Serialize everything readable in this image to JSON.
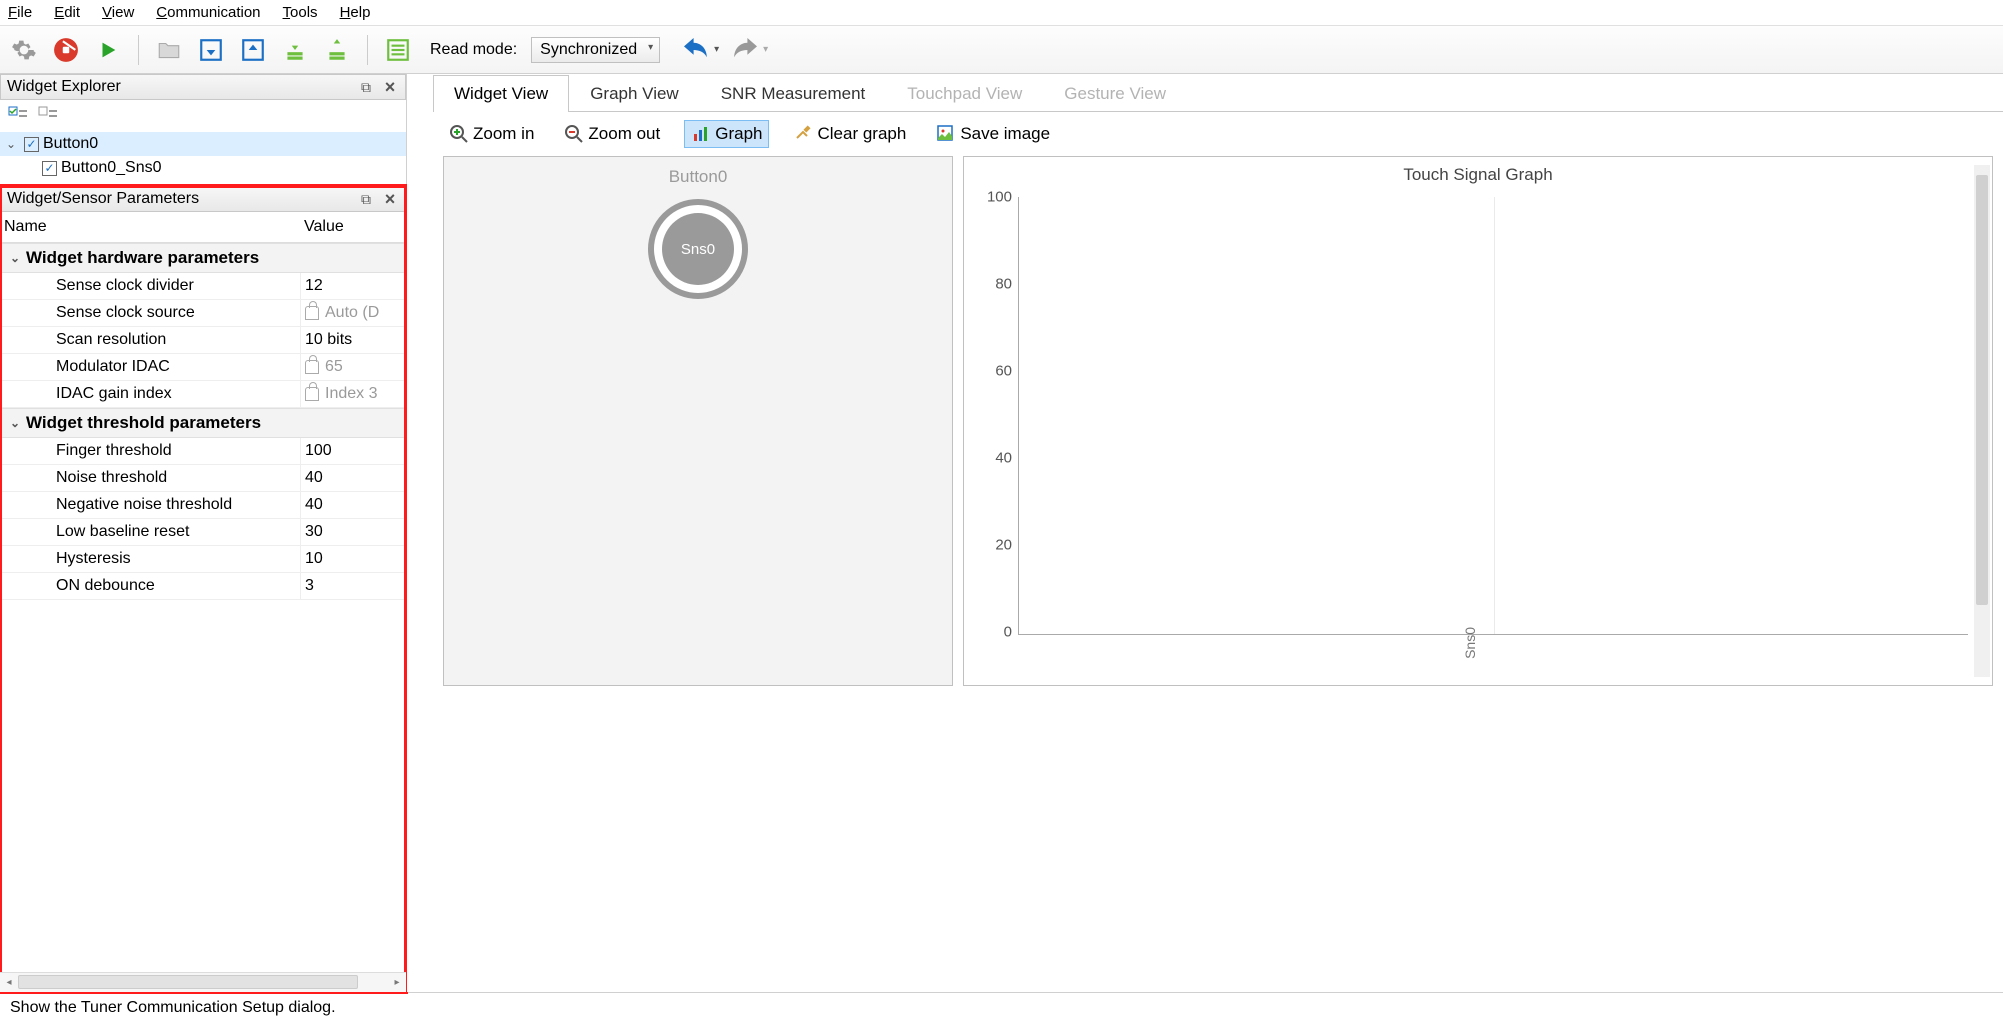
{
  "menubar": [
    "File",
    "Edit",
    "View",
    "Communication",
    "Tools",
    "Help"
  ],
  "toolbar": {
    "read_mode_label": "Read mode:",
    "read_mode_value": "Synchronized"
  },
  "panels": {
    "widget_explorer": {
      "title": "Widget Explorer"
    },
    "params": {
      "title": "Widget/Sensor Parameters",
      "col_name": "Name",
      "col_value": "Value"
    }
  },
  "tree": {
    "root": {
      "label": "Button0",
      "checked": true,
      "expanded": true
    },
    "child": {
      "label": "Button0_Sns0",
      "checked": true
    }
  },
  "param_groups": [
    {
      "title": "Widget hardware parameters",
      "rows": [
        {
          "name": "Sense clock divider",
          "value": "12",
          "locked": false
        },
        {
          "name": "Sense clock source",
          "value": "Auto (D",
          "locked": true
        },
        {
          "name": "Scan resolution",
          "value": "10 bits",
          "locked": false
        },
        {
          "name": "Modulator IDAC",
          "value": "65",
          "locked": true
        },
        {
          "name": "IDAC gain index",
          "value": "Index 3",
          "locked": true
        }
      ]
    },
    {
      "title": "Widget threshold parameters",
      "rows": [
        {
          "name": "Finger threshold",
          "value": "100",
          "locked": false
        },
        {
          "name": "Noise threshold",
          "value": "40",
          "locked": false
        },
        {
          "name": "Negative noise threshold",
          "value": "40",
          "locked": false
        },
        {
          "name": "Low baseline reset",
          "value": "30",
          "locked": false
        },
        {
          "name": "Hysteresis",
          "value": "10",
          "locked": false
        },
        {
          "name": "ON debounce",
          "value": "3",
          "locked": false
        }
      ]
    }
  ],
  "tabs": [
    {
      "label": "Widget View",
      "active": true
    },
    {
      "label": "Graph View"
    },
    {
      "label": "SNR Measurement"
    },
    {
      "label": "Touchpad View",
      "disabled": true
    },
    {
      "label": "Gesture View",
      "disabled": true
    }
  ],
  "view_toolbar": {
    "zoom_in": "Zoom in",
    "zoom_out": "Zoom out",
    "graph": "Graph",
    "clear": "Clear graph",
    "save": "Save image"
  },
  "widget_view": {
    "title": "Button0",
    "sensor_label": "Sns0"
  },
  "chart_data": {
    "type": "line",
    "title": "Touch Signal Graph",
    "xlabel": "",
    "ylabel": "",
    "ylim": [
      0,
      100
    ],
    "yticks": [
      0,
      20,
      40,
      60,
      80,
      100
    ],
    "categories": [
      "Sns0"
    ],
    "series": []
  },
  "statusbar": "Show the Tuner Communication Setup dialog."
}
